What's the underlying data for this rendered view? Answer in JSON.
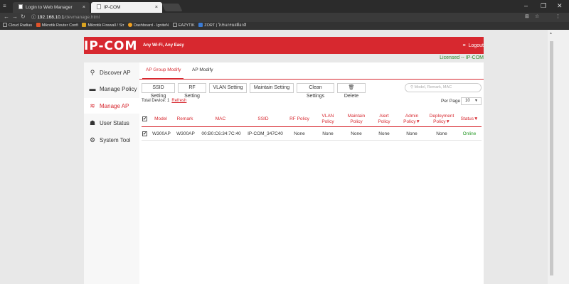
{
  "browser": {
    "tabs": [
      {
        "label": "Login to Web Manager"
      },
      {
        "label": "IP-COM"
      }
    ],
    "address": {
      "host": "192.168.10.1",
      "path": "/devmanage.html"
    },
    "bookmarks": [
      {
        "label": "Cloud Radius",
        "icon_color": "#dddddd"
      },
      {
        "label": "Mikrotik Router Confi",
        "icon_color": "#e0532a"
      },
      {
        "label": "Mikrotik Firewall / Str",
        "icon_color": "#d9a320"
      },
      {
        "label": "Dashboard - IgniteN",
        "icon_color": "#f0a020"
      },
      {
        "label": "EAZYTIK",
        "icon_color": "#dddddd"
      },
      {
        "label": "ZORT | โปรแกรมสต็อกสิ",
        "icon_color": "#3a7bd5"
      }
    ]
  },
  "header": {
    "logo": "IP-COM",
    "tagline": "Any Wi-Fi, Any Easy",
    "logout": "Logout",
    "licensed": "Licensed -- IP-COM"
  },
  "sidebar": {
    "items": [
      {
        "label": "Discover AP",
        "icon": "antenna-icon"
      },
      {
        "label": "Manage Policy",
        "icon": "briefcase-icon"
      },
      {
        "label": "Manage AP",
        "icon": "wifi-icon"
      },
      {
        "label": "User Status",
        "icon": "users-icon"
      },
      {
        "label": "System Tool",
        "icon": "gears-icon"
      }
    ]
  },
  "subtabs": [
    "AP Group Modify",
    "AP Modify"
  ],
  "toolbar": {
    "buttons": [
      "SSID Setting",
      "RF Setting",
      "VLAN Setting",
      "Maintain Setting",
      "Clean Settings",
      "Delete"
    ],
    "search_placeholder": "Model, Remark, MAC"
  },
  "summary": {
    "total": "Total Device: 1",
    "refresh": "Refresh",
    "per_page_label": "Per Page",
    "per_page_value": "10"
  },
  "table": {
    "headers": {
      "model": "Model",
      "remark": "Remark",
      "mac": "MAC",
      "ssid": "SSID",
      "rf": "RF Policy",
      "vlan": "VLAN Policy",
      "maintain": "Maintain Policy",
      "alert": "Alert Policy",
      "admin": "Admin Policy▼",
      "deploy": "Deployment Policy▼",
      "status": "Status▼"
    },
    "rows": [
      {
        "model": "W300AP",
        "remark": "W300AP",
        "mac": "00:B0:C6:34:7C:40",
        "ssid": "IP-COM_347C40",
        "rf": "None",
        "vlan": "None",
        "maintain": "None",
        "alert": "None",
        "admin": "None",
        "deploy": "None",
        "status": "Online"
      }
    ]
  },
  "colors": {
    "brand_red": "#d7282f",
    "online_green": "#2a9a2a"
  }
}
